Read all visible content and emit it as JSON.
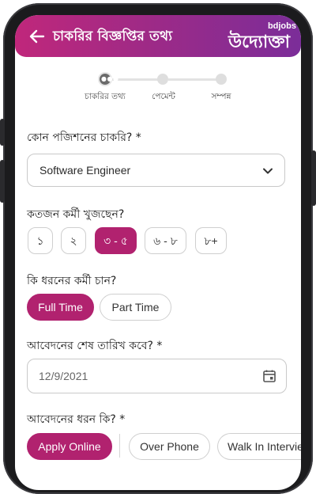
{
  "header": {
    "title": "চাকরির বিজ্ঞপ্তির তথ্য",
    "brand_small": "bdjobs",
    "brand_main": "উদ্যোক্তা"
  },
  "stepper": {
    "steps": [
      {
        "label": "চাকরির তথ্য",
        "state": "active"
      },
      {
        "label": "পেমেন্ট",
        "state": "pending"
      },
      {
        "label": "সম্পন্ন",
        "state": "pending"
      }
    ]
  },
  "position": {
    "label": "কোন পজিশনের চাকরি? *",
    "value": "Software Engineer"
  },
  "workers": {
    "label": "কতজন কর্মী খুজছেন?",
    "options": [
      "১",
      "২",
      "৩ - ৫",
      "৬ - ৮",
      "৮+"
    ],
    "selected": "৩ - ৫"
  },
  "worker_type": {
    "label": "কি ধরনের কর্মী চান?",
    "options": [
      "Full Time",
      "Part Time"
    ],
    "selected": "Full Time"
  },
  "deadline": {
    "label": "আবেদনের শেষ তারিখ কবে? *",
    "value": "12/9/2021"
  },
  "apply_type": {
    "label": "আবেদনের ধরন কি? *",
    "options": [
      "Apply Online",
      "Over Phone",
      "Walk In Interview"
    ],
    "selected": "Apply Online"
  },
  "colors": {
    "accent": "#b1226f",
    "header_start": "#c0277b",
    "header_end": "#7b2d99",
    "frame": "#1b1b1d"
  },
  "icons": {
    "back": "arrow-left-icon",
    "dropdown": "chevron-down-icon",
    "date": "calendar-icon",
    "step_active": "more-dots-icon"
  }
}
